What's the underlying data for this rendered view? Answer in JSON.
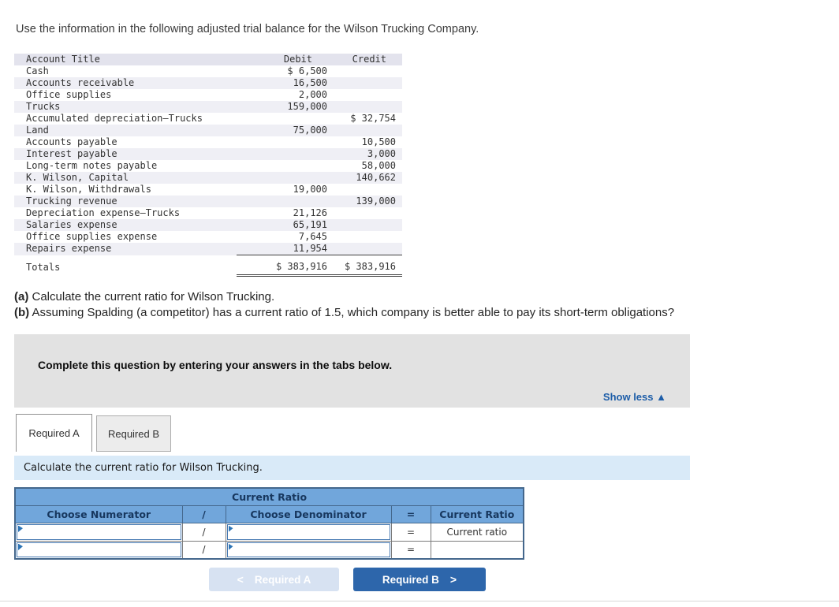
{
  "intro": "Use the information in the following adjusted trial balance for the Wilson Trucking Company.",
  "trial_balance": {
    "header": {
      "account": "Account Title",
      "debit": "Debit",
      "credit": "Credit"
    },
    "rows": [
      {
        "account": "Cash",
        "debit": "$ 6,500",
        "credit": ""
      },
      {
        "account": "Accounts receivable",
        "debit": "16,500",
        "credit": ""
      },
      {
        "account": "Office supplies",
        "debit": "2,000",
        "credit": ""
      },
      {
        "account": "Trucks",
        "debit": "159,000",
        "credit": ""
      },
      {
        "account": "Accumulated depreciation—Trucks",
        "debit": "",
        "credit": "$ 32,754"
      },
      {
        "account": "Land",
        "debit": "75,000",
        "credit": ""
      },
      {
        "account": "Accounts payable",
        "debit": "",
        "credit": "10,500"
      },
      {
        "account": "Interest payable",
        "debit": "",
        "credit": "3,000"
      },
      {
        "account": "Long-term notes payable",
        "debit": "",
        "credit": "58,000"
      },
      {
        "account": "K. Wilson, Capital",
        "debit": "",
        "credit": "140,662"
      },
      {
        "account": "K. Wilson, Withdrawals",
        "debit": "19,000",
        "credit": ""
      },
      {
        "account": "Trucking revenue",
        "debit": "",
        "credit": "139,000"
      },
      {
        "account": "Depreciation expense—Trucks",
        "debit": "21,126",
        "credit": ""
      },
      {
        "account": "Salaries expense",
        "debit": "65,191",
        "credit": ""
      },
      {
        "account": "Office supplies expense",
        "debit": "7,645",
        "credit": ""
      },
      {
        "account": "Repairs expense",
        "debit": "11,954",
        "credit": ""
      }
    ],
    "totals": {
      "label": "Totals",
      "debit": "$ 383,916",
      "credit": "$ 383,916"
    }
  },
  "questions": {
    "a_label": "(a)",
    "a_text": " Calculate the current ratio for Wilson Trucking.",
    "b_label": "(b)",
    "b_text": " Assuming Spalding (a competitor) has a current ratio of 1.5, which company is better able to pay its short-term obligations?"
  },
  "panel": {
    "instruction": "Complete this question by entering your answers in the tabs below.",
    "show_less_label": "Show less",
    "show_less_icon": "▲"
  },
  "tabs": {
    "a": "Required A",
    "b": "Required B"
  },
  "tab_bar": {
    "instruction": "Calculate the current ratio for Wilson Trucking."
  },
  "ratio_table": {
    "title": "Current Ratio",
    "headers": {
      "numerator": "Choose Numerator",
      "slash": "/",
      "denominator": "Choose Denominator",
      "equals": "=",
      "result": "Current Ratio"
    },
    "rows": [
      {
        "slash": "/",
        "equals": "=",
        "result": "Current ratio"
      },
      {
        "slash": "/",
        "equals": "=",
        "result": ""
      }
    ]
  },
  "nav": {
    "prev_icon": "<",
    "prev_label": "Required A",
    "next_label": "Required B",
    "next_icon": ">"
  },
  "colors": {
    "table_header_blue": "#71a6db",
    "header_text_navy": "#17375e",
    "link_blue": "#1d5da8",
    "button_primary": "#2d66ab",
    "button_disabled": "#d7e2f2",
    "info_bar_blue": "#d9eaf8",
    "panel_gray": "#e2e2e2",
    "dropdown_border": "#4679b2",
    "dropdown_flag": "#2e75b6"
  }
}
